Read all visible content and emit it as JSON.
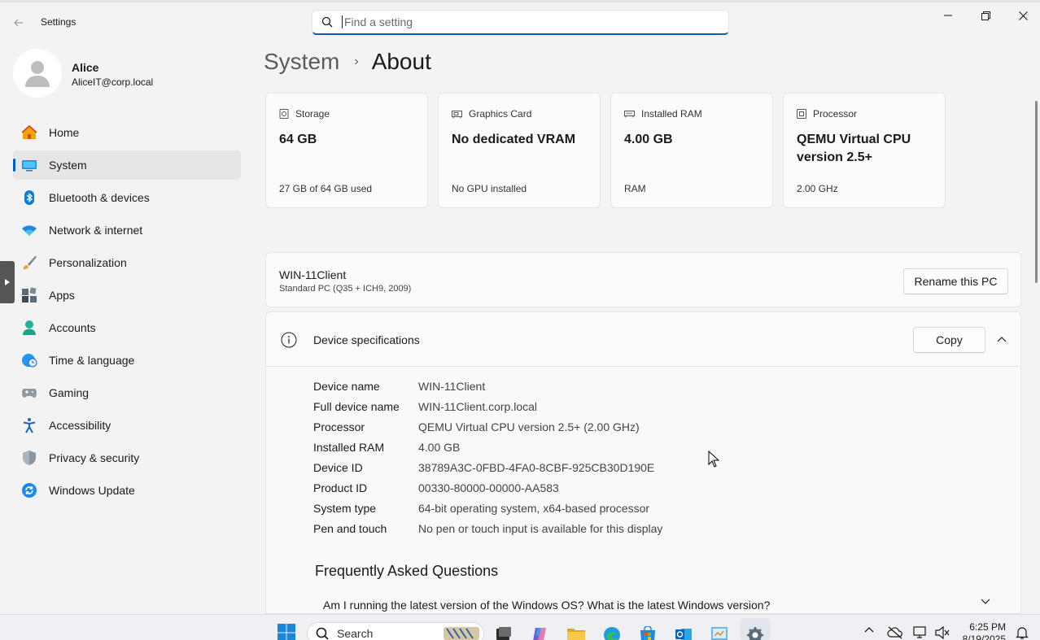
{
  "window": {
    "title": "Settings",
    "search_placeholder": "Find a setting"
  },
  "profile": {
    "name": "Alice",
    "email": "AliceIT@corp.local"
  },
  "sidebar": {
    "items": [
      {
        "label": "Home",
        "icon": "home-icon"
      },
      {
        "label": "System",
        "icon": "system-icon",
        "active": true
      },
      {
        "label": "Bluetooth & devices",
        "icon": "bluetooth-icon"
      },
      {
        "label": "Network & internet",
        "icon": "wifi-icon"
      },
      {
        "label": "Personalization",
        "icon": "brush-icon"
      },
      {
        "label": "Apps",
        "icon": "apps-icon"
      },
      {
        "label": "Accounts",
        "icon": "accounts-icon"
      },
      {
        "label": "Time & language",
        "icon": "globe-clock-icon"
      },
      {
        "label": "Gaming",
        "icon": "gamepad-icon"
      },
      {
        "label": "Accessibility",
        "icon": "accessibility-icon"
      },
      {
        "label": "Privacy & security",
        "icon": "shield-icon"
      },
      {
        "label": "Windows Update",
        "icon": "update-icon"
      }
    ]
  },
  "breadcrumb": {
    "parent": "System",
    "separator": "›",
    "current": "About"
  },
  "cards": [
    {
      "title": "Storage",
      "value": "64 GB",
      "sub": "27 GB of 64 GB used",
      "icon": "storage-icon"
    },
    {
      "title": "Graphics Card",
      "value": "No dedicated VRAM",
      "sub": "No GPU installed",
      "icon": "graphics-card-icon"
    },
    {
      "title": "Installed RAM",
      "value": "4.00 GB",
      "sub": "RAM",
      "icon": "ram-icon"
    },
    {
      "title": "Processor",
      "value": "QEMU Virtual CPU version 2.5+",
      "sub": "2.00 GHz",
      "icon": "processor-icon"
    }
  ],
  "pc": {
    "name": "WIN-11Client",
    "model": "Standard PC (Q35 + ICH9, 2009)",
    "rename_label": "Rename this PC"
  },
  "specs": {
    "title": "Device specifications",
    "copy_label": "Copy",
    "rows": [
      {
        "key": "Device name",
        "value": "WIN-11Client"
      },
      {
        "key": "Full device name",
        "value": "WIN-11Client.corp.local"
      },
      {
        "key": "Processor",
        "value": "QEMU Virtual CPU version 2.5+ (2.00 GHz)"
      },
      {
        "key": "Installed RAM",
        "value": "4.00 GB"
      },
      {
        "key": "Device ID",
        "value": "38789A3C-0FBD-4FA0-8CBF-925CB30D190E"
      },
      {
        "key": "Product ID",
        "value": "00330-80000-00000-AA583"
      },
      {
        "key": "System type",
        "value": "64-bit operating system, x64-based processor"
      },
      {
        "key": "Pen and touch",
        "value": "No pen or touch input is available for this display"
      }
    ]
  },
  "faq": {
    "title": "Frequently Asked Questions",
    "question": "Am I running the latest version of the Windows OS? What is the latest Windows version?"
  },
  "taskbar": {
    "search_label": "Search",
    "time": "6:25 PM",
    "date": "8/19/2025"
  },
  "colors": {
    "accent": "#005fb8",
    "background": "#f3f3f3",
    "card": "#fbfbfb"
  }
}
